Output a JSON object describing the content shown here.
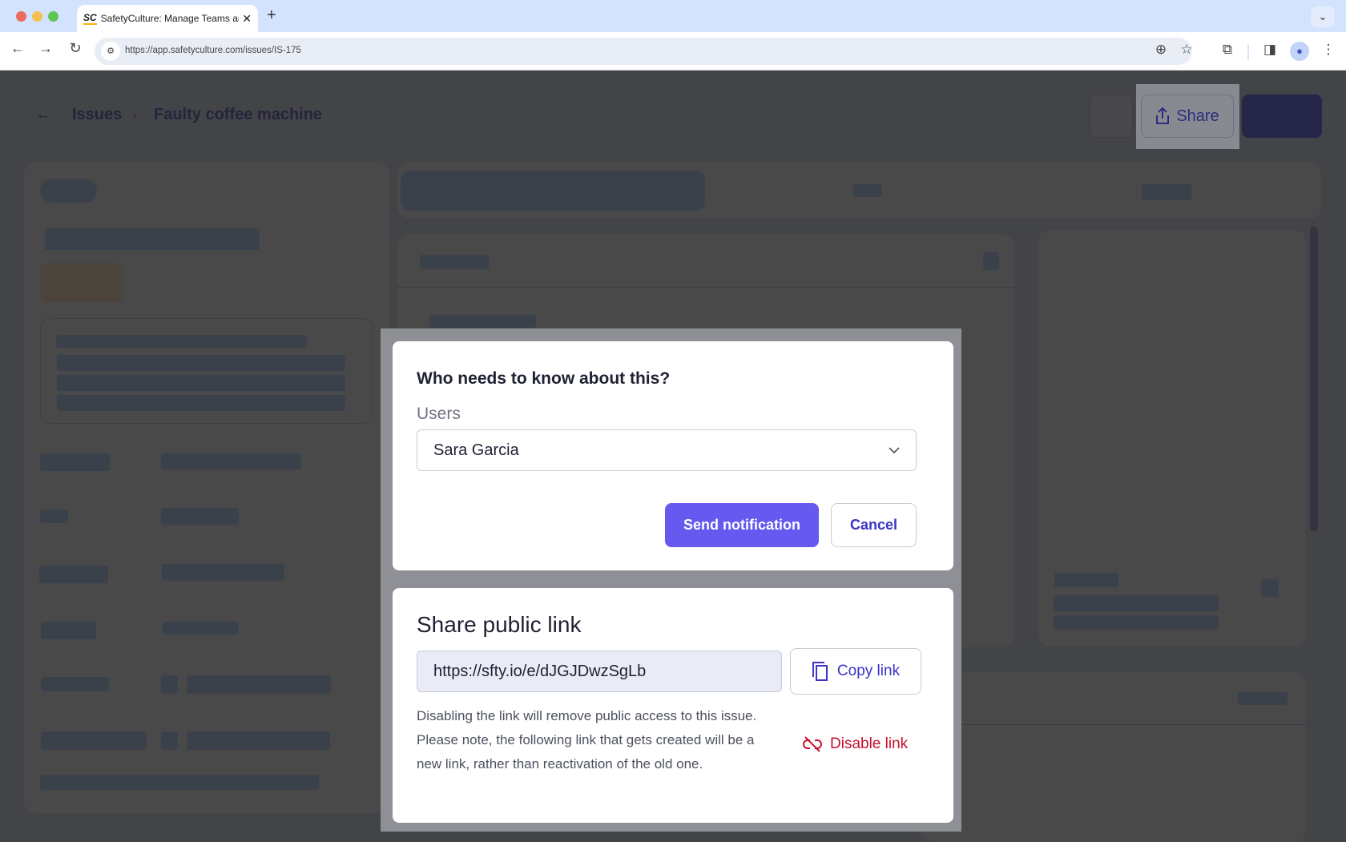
{
  "browser": {
    "tab_title": "SafetyCulture: Manage Teams and...",
    "tab_favicon": "SC",
    "new_tab_label": "+",
    "url": "https://app.safetyculture.com/issues/IS-175",
    "icons": [
      "back-icon",
      "forward-icon",
      "reload-icon",
      "site-info-icon",
      "zoom-icon",
      "bookmark-star-icon",
      "extensions-icon",
      "side-panel-icon",
      "profile-icon",
      "menu-icon",
      "tab-search-icon"
    ]
  },
  "header": {
    "breadcrumb": [
      {
        "label": "Issues"
      },
      {
        "label": "Faulty coffee machine"
      }
    ],
    "share_label": "Share"
  },
  "notify_card": {
    "title": "Who needs to know about this?",
    "users_label": "Users",
    "selected_user": "Sara Garcia",
    "send_label": "Send notification",
    "cancel_label": "Cancel"
  },
  "public_link_card": {
    "title": "Share public link",
    "link_value": "https://sfty.io/e/dJGJDwzSgLb",
    "copy_label": "Copy link",
    "help_text": "Disabling the link will remove public access to this issue. Please note, the following link that gets created will be a new link, rather than reactivation of the old one.",
    "disable_label": "Disable link"
  },
  "colors": {
    "primary": "#6559f0",
    "link": "#3b34c4",
    "danger": "#c8102e",
    "overlay": "#434448"
  }
}
